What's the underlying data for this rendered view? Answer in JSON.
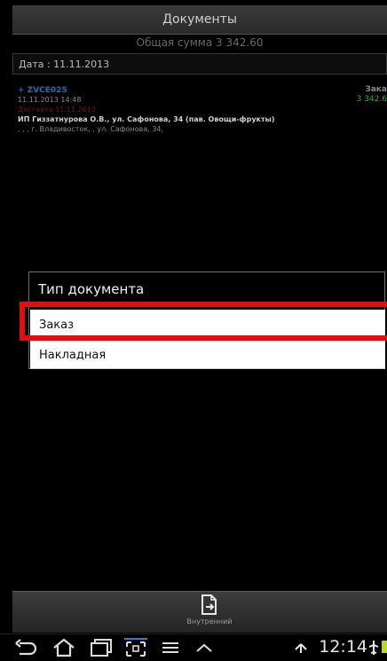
{
  "header": {
    "title": "Документы",
    "total": "Общая сумма 3 342.60"
  },
  "date_filter": "Дата : 11.11.2013",
  "document": {
    "code": "+ ZVCE025",
    "type_short": "Зака",
    "datetime": "11.11.2013 14:48",
    "sum_short": "3 342.6",
    "delivery": "Доставка 11.11.2013",
    "client": "ИП Гиззатнурова О.В., ул. Сафонова, 34 (пав. Овощи-фрукты)",
    "address": ", , , г. Владивосток, , ул. Сафонова, 34,"
  },
  "dialog": {
    "title": "Тип документа",
    "options": [
      "Заказ",
      "Накладная"
    ]
  },
  "toolbar": {
    "button_label": "Внутренний"
  },
  "status": {
    "time": "12:14"
  },
  "colors": {
    "highlight": "#e01010",
    "code_blue": "#1f6fb3",
    "sum_green": "#2fb34a"
  }
}
